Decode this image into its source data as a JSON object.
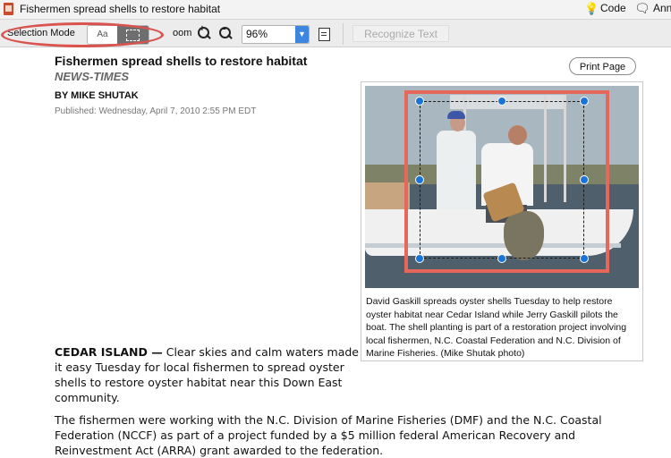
{
  "window": {
    "title": "Fishermen spread shells to restore habitat",
    "right_items": [
      "Code",
      "Ann"
    ]
  },
  "toolbar": {
    "selection_mode_label": "Selection Mode",
    "text_mode_label": "Aa",
    "zoom_label": "oom",
    "zoom_value": "96%",
    "recognize_text_label": "Recognize Text"
  },
  "article": {
    "title": "Fishermen spread shells to restore habitat",
    "source": "NEWS-TIMES",
    "byline": "BY MIKE SHUTAK",
    "published": "Published: Wednesday, April 7, 2010 2:55 PM EDT",
    "print_label": "Print Page",
    "caption": "David Gaskill spreads oyster shells Tuesday to help restore oyster habitat near Cedar Island while Jerry Gaskill pilots the boat. The shell planting is part of a restoration project involving local fishermen, N.C. Coastal Federation and N.C. Division of Marine Fisheries. (Mike Shutak photo)",
    "dateline": "CEDAR ISLAND —",
    "paragraph1": "Clear skies and calm waters made it easy Tuesday for local fishermen to spread oyster shells to restore oyster habitat near this Down East community.",
    "paragraph2": "The fishermen were working with the N.C. Division of Marine Fisheries (DMF) and the N.C. Coastal Federation (NCCF) as part of a project funded by a $5 million federal American Recovery and Reinvestment Act (ARRA) grant awarded to the federation."
  },
  "colors": {
    "highlight_ellipse": "#d9534f",
    "selection_frame": "#e5685b",
    "handle": "#1a73d8",
    "select_accent": "#3d86df"
  },
  "icons": [
    "document-icon",
    "lightbulb-icon",
    "comment-icon",
    "zoom-in-icon",
    "zoom-out-icon",
    "fit-page-icon",
    "chevron-down-icon"
  ]
}
